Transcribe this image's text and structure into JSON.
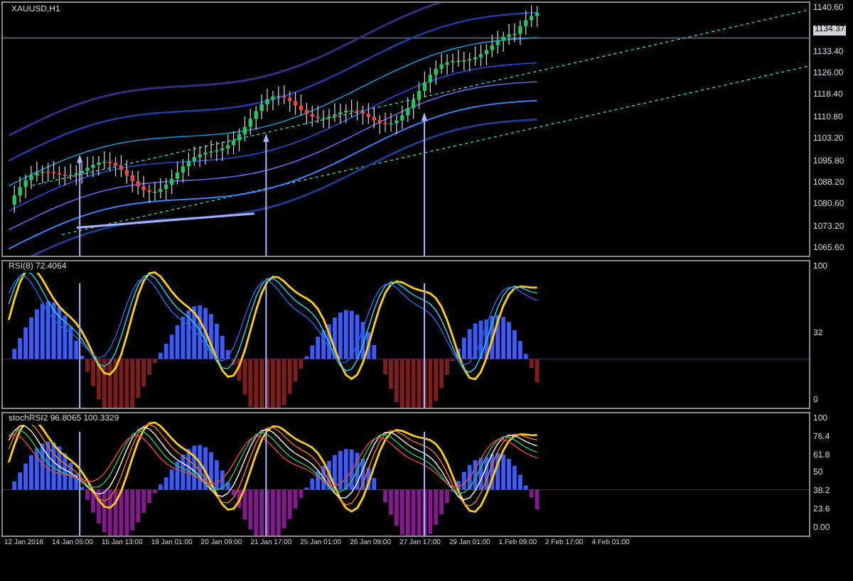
{
  "chart": {
    "symbol": "XAUUSD,H1",
    "price_axis": [
      {
        "kind": "tick",
        "text": "1140.60"
      },
      {
        "kind": "current",
        "text": "1134.37"
      },
      {
        "kind": "tick",
        "text": "1133.40"
      },
      {
        "kind": "tick",
        "text": "1126.00"
      },
      {
        "kind": "tick",
        "text": "1118.40"
      },
      {
        "kind": "tick",
        "text": "1110.80"
      },
      {
        "kind": "tick",
        "text": "1103.20"
      },
      {
        "kind": "tick",
        "text": "1095.80"
      },
      {
        "kind": "tick",
        "text": "1088.20"
      },
      {
        "kind": "tick",
        "text": "1080.60"
      },
      {
        "kind": "tick",
        "text": "1073.20"
      },
      {
        "kind": "tick",
        "text": "1065.60"
      }
    ],
    "time_axis": [
      "12 Jan 2016",
      "14 Jan 05:00",
      "15 Jan 13:00",
      "19 Jan 01:00",
      "20 Jan 09:00",
      "21 Jan 17:00",
      "25 Jan 01:00",
      "26 Jan 09:00",
      "27 Jan 17:00",
      "29 Jan 01:00",
      "1 Feb 09:00",
      "2 Feb 17:00",
      "4 Feb 01:00"
    ]
  },
  "rsi": {
    "label": "RSI(8) 72.4064",
    "axis": [
      "100",
      "32",
      "0"
    ]
  },
  "stoch": {
    "label": "stochRSI2 96.8065 100.3329",
    "axis": [
      "100",
      "76.4",
      "61.8",
      "50",
      "38.2",
      "23.6",
      "0.00"
    ]
  }
}
